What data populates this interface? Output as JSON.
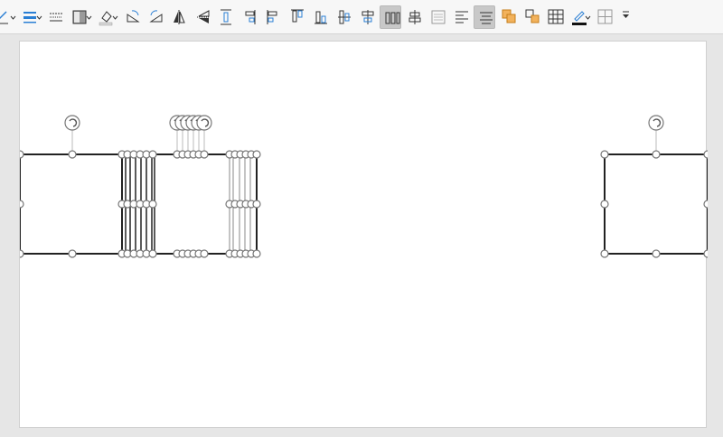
{
  "toolbar": {
    "items": [
      {
        "icon": "line-style-icon",
        "dropdown": true
      },
      {
        "icon": "line-width-icon",
        "dropdown": true
      },
      {
        "icon": "line-dash-icon"
      },
      {
        "icon": "area-fill-icon",
        "dropdown": true
      },
      {
        "icon": "fill-color-icon",
        "dropdown": true
      },
      {
        "icon": "rotate-right-icon"
      },
      {
        "icon": "rotate-left-icon"
      },
      {
        "icon": "flip-vertical-icon"
      },
      {
        "icon": "flip-horizontal-icon"
      },
      {
        "icon": "distribute-vertical-icon"
      },
      {
        "icon": "align-right-icon"
      },
      {
        "icon": "align-left-icon"
      },
      {
        "icon": "align-top-icon"
      },
      {
        "icon": "align-bottom-icon"
      },
      {
        "icon": "align-center-horizontal-icon"
      },
      {
        "icon": "align-center-vertical-icon"
      },
      {
        "icon": "distribute-horizontal-icon",
        "active": true
      },
      {
        "icon": "distribute-center-icon"
      },
      {
        "icon": "wrap-text-icon"
      },
      {
        "icon": "text-align-left-icon"
      },
      {
        "icon": "text-align-center-icon",
        "active": true
      },
      {
        "icon": "bring-to-front-icon"
      },
      {
        "icon": "send-to-back-icon"
      },
      {
        "icon": "insert-table-icon"
      },
      {
        "icon": "line-color-icon",
        "dropdown": true
      },
      {
        "icon": "borders-icon"
      },
      {
        "icon": "more-options-icon"
      }
    ]
  },
  "colors": {
    "toolbar_bg": "#f7f7f7",
    "page_bg": "#ffffff",
    "workspace_bg": "#e6e6e6",
    "shape_stroke": "#222222",
    "handle_stroke": "#777777",
    "accent_blue": "#2a7fd4",
    "active_button": "#c8c8c8"
  },
  "canvas": {
    "shapes": [
      {
        "name": "shape-rect-left",
        "selected": true
      },
      {
        "name": "shape-stack-lines",
        "selected": true,
        "count": 5
      },
      {
        "name": "shape-rect-middle",
        "selected": true
      },
      {
        "name": "shape-stack-lines-right",
        "selected": true,
        "count": 4
      },
      {
        "name": "shape-rect-right",
        "selected": true
      }
    ]
  }
}
